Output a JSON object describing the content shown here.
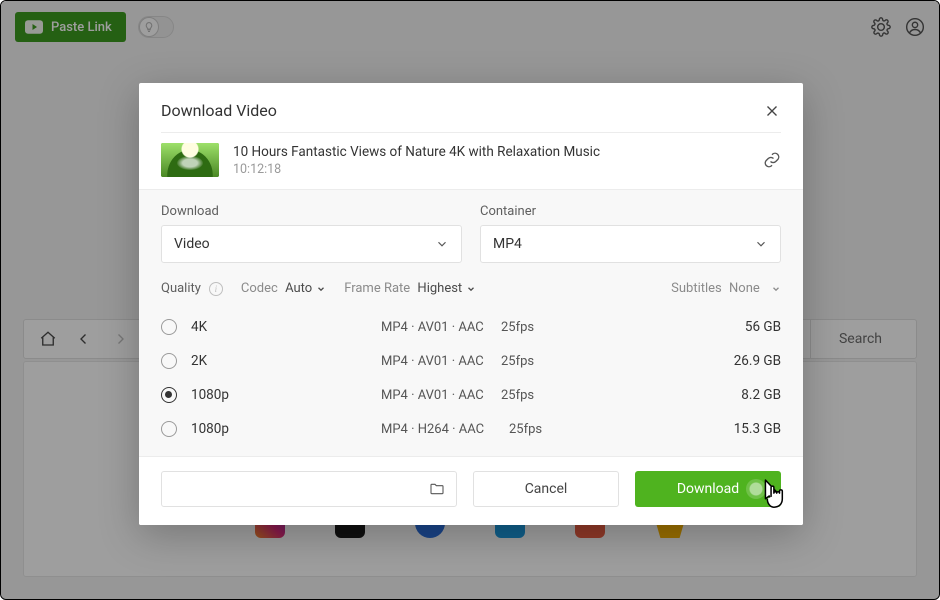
{
  "topbar": {
    "paste_label": "Paste Link"
  },
  "browser": {
    "search_label": "Search"
  },
  "dialog": {
    "title": "Download Video",
    "video_title": "10 Hours Fantastic Views of Nature 4K with Relaxation Music",
    "video_duration": "10:12:18",
    "selects": {
      "download_label": "Download",
      "download_value": "Video",
      "container_label": "Container",
      "container_value": "MP4"
    },
    "filters": {
      "quality_label": "Quality",
      "codec_label": "Codec",
      "codec_value": "Auto",
      "framerate_label": "Frame Rate",
      "framerate_value": "Highest",
      "subtitles_label": "Subtitles",
      "subtitles_value": "None"
    },
    "qualities": [
      {
        "name": "4K",
        "format": "MP4 · AV01 · AAC",
        "fps": "25fps",
        "size": "56 GB",
        "selected": false
      },
      {
        "name": "2K",
        "format": "MP4 · AV01 · AAC",
        "fps": "25fps",
        "size": "26.9 GB",
        "selected": false
      },
      {
        "name": "1080p",
        "format": "MP4 · AV01 · AAC",
        "fps": "25fps",
        "size": "8.2 GB",
        "selected": true
      },
      {
        "name": "1080p",
        "format": "MP4 · H264 · AAC",
        "fps": "25fps",
        "size": "15.3 GB",
        "selected": false
      }
    ],
    "footer": {
      "cancel_label": "Cancel",
      "download_label": "Download"
    }
  }
}
